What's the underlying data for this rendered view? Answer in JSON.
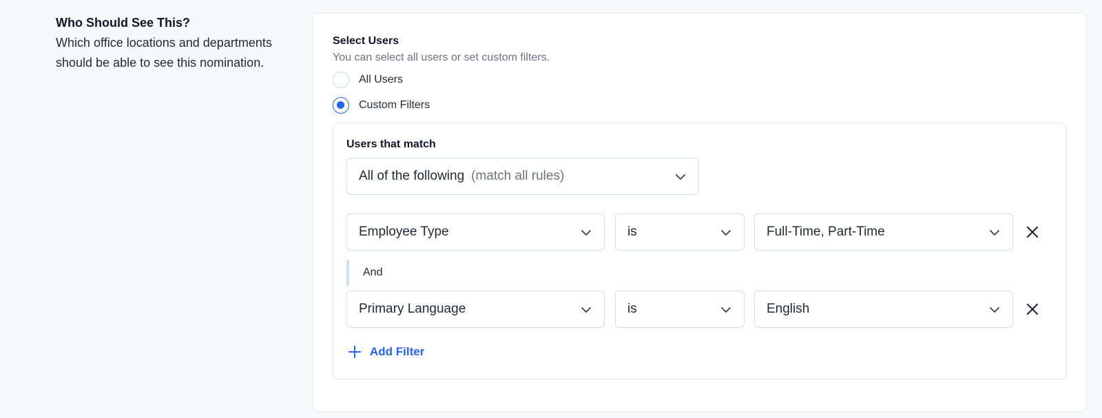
{
  "section": {
    "title": "Who Should See This?",
    "description": "Which office locations and departments should be able to see this nomination."
  },
  "select_users": {
    "label": "Select Users",
    "help": "You can select all users or set custom filters.",
    "options": [
      {
        "label": "All Users",
        "checked": false
      },
      {
        "label": "Custom Filters",
        "checked": true
      }
    ]
  },
  "filters": {
    "match_label": "Users that match",
    "match_mode": {
      "value": "All of the following",
      "hint": "(match all rules)"
    },
    "rules": [
      {
        "field": "Employee Type",
        "operator": "is",
        "value": "Full-Time, Part-Time"
      },
      {
        "field": "Primary Language",
        "operator": "is",
        "value": "English"
      }
    ],
    "connector": "And",
    "add_filter_label": "Add Filter"
  },
  "colors": {
    "accent": "#2563eb",
    "connector_bar": "#cfe0fb",
    "page_bg": "#f8f9fb"
  },
  "icons": {
    "chevron": "chevron-down-icon",
    "remove": "close-icon",
    "add": "plus-icon"
  }
}
